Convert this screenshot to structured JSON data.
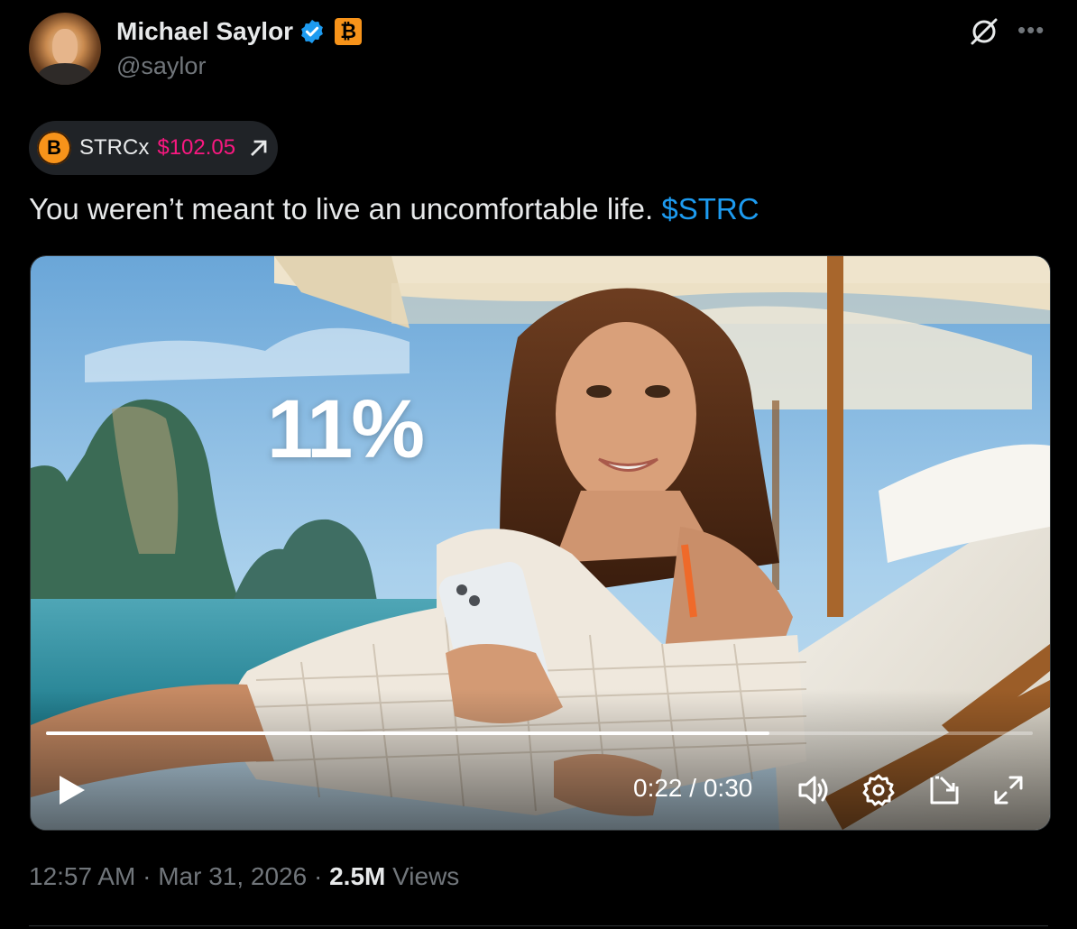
{
  "author": {
    "name": "Michael Saylor",
    "handle": "@saylor",
    "badge_symbol": "₿"
  },
  "cashtag_chip": {
    "logo_symbol": "B",
    "ticker": "STRCx",
    "price": "$102.05"
  },
  "tweet": {
    "text": "You weren’t meant to live an uncomfortable life.",
    "cashtag": "$STRC"
  },
  "video": {
    "overlay_text": "11%",
    "current_time": "0:22",
    "time_separator": " / ",
    "duration": "0:30",
    "progress_fraction": 0.7333
  },
  "meta": {
    "time": "12:57 AM",
    "separator": "·",
    "date": "Mar 31, 2026",
    "views_count": "2.5M",
    "views_label": "Views"
  },
  "colors": {
    "background": "#000000",
    "cashtag": "#1d9bf0",
    "price": "#f91880",
    "bitcoin_orange": "#f7931a",
    "muted": "#71767b"
  },
  "icons": [
    "verified-icon",
    "bitcoin-badge-icon",
    "grok-icon",
    "more-icon",
    "arrow-up-right-icon",
    "play-icon",
    "volume-icon",
    "settings-icon",
    "pip-icon",
    "fullscreen-icon"
  ]
}
